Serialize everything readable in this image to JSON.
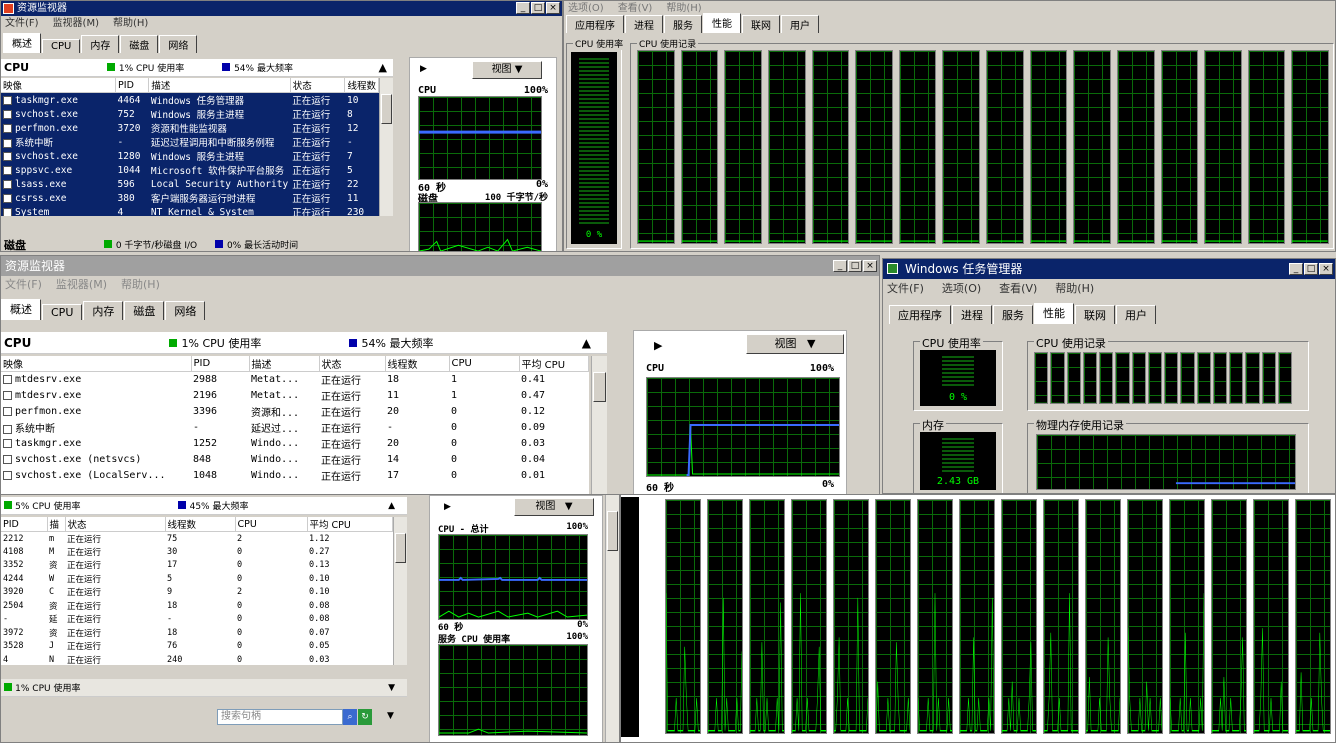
{
  "top_rm": {
    "title": "资源监视器",
    "menu": [
      "文件(F)",
      "监视器(M)",
      "帮助(H)"
    ],
    "tabs": [
      "概述",
      "CPU",
      "内存",
      "磁盘",
      "网络"
    ],
    "cpu_head": {
      "label": "CPU",
      "usage": "1% CPU 使用率",
      "freq": "54% 最大频率"
    },
    "columns": [
      "映像",
      "PID",
      "描述",
      "状态",
      "线程数"
    ],
    "rows": [
      [
        "taskmgr.exe",
        "4464",
        "Windows 任务管理器",
        "正在运行",
        "10"
      ],
      [
        "svchost.exe",
        "752",
        "Windows 服务主进程",
        "正在运行",
        "8"
      ],
      [
        "perfmon.exe",
        "3720",
        "资源和性能监视器",
        "正在运行",
        "12"
      ],
      [
        "系统中断",
        "-",
        "延迟过程调用和中断服务例程",
        "正在运行",
        "-"
      ],
      [
        "svchost.exe",
        "1280",
        "Windows 服务主进程",
        "正在运行",
        "7"
      ],
      [
        "sppsvc.exe",
        "1044",
        "Microsoft 软件保护平台服务",
        "正在运行",
        "5"
      ],
      [
        "lsass.exe",
        "596",
        "Local Security Authority",
        "正在运行",
        "22"
      ],
      [
        "csrss.exe",
        "380",
        "客户端服务器运行时进程",
        "正在运行",
        "11"
      ],
      [
        "System",
        "4",
        "NT Kernel & System",
        "正在运行",
        "230"
      ]
    ],
    "disk_head": {
      "label": "磁盘",
      "io": "0 千字节/秒磁盘 I/O",
      "active": "0% 最长活动时间"
    },
    "view_btn": "视图",
    "graph_cpu": {
      "label": "CPU",
      "max": "100%"
    },
    "graph_axis": {
      "time": "60 秒",
      "min": "0%"
    },
    "graph_disk": {
      "label": "磁盘",
      "max": "100 千字节/秒"
    }
  },
  "top_tm": {
    "menu": [
      "选项(O)",
      "查看(V)",
      "帮助(H)"
    ],
    "tabs": [
      "应用程序",
      "进程",
      "服务",
      "性能",
      "联网",
      "用户"
    ],
    "cpu_usage_label": "CPU 使用率",
    "cpu_history_label": "CPU 使用记录",
    "cpu_pct": "0 %"
  },
  "mid_rm": {
    "title": "资源监视器",
    "menu": [
      "文件(F)",
      "监视器(M)",
      "帮助(H)"
    ],
    "tabs": [
      "概述",
      "CPU",
      "内存",
      "磁盘",
      "网络"
    ],
    "cpu_head": {
      "label": "CPU",
      "usage": "1% CPU 使用率",
      "freq": "54% 最大频率"
    },
    "columns": [
      "映像",
      "PID",
      "描述",
      "状态",
      "线程数",
      "CPU",
      "平均 CPU"
    ],
    "rows": [
      [
        "mtdesrv.exe",
        "2988",
        "Metat...",
        "正在运行",
        "18",
        "1",
        "0.41"
      ],
      [
        "mtdesrv.exe",
        "2196",
        "Metat...",
        "正在运行",
        "11",
        "1",
        "0.47"
      ],
      [
        "perfmon.exe",
        "3396",
        "资源和...",
        "正在运行",
        "20",
        "0",
        "0.12"
      ],
      [
        "系统中断",
        "-",
        "延迟过...",
        "正在运行",
        "-",
        "0",
        "0.09"
      ],
      [
        "taskmgr.exe",
        "1252",
        "Windo...",
        "正在运行",
        "20",
        "0",
        "0.03"
      ],
      [
        "svchost.exe (netsvcs)",
        "848",
        "Windo...",
        "正在运行",
        "14",
        "0",
        "0.04"
      ],
      [
        "svchost.exe (LocalServ...",
        "1048",
        "Windo...",
        "正在运行",
        "17",
        "0",
        "0.01"
      ]
    ],
    "view_btn": "视图",
    "graph_cpu": {
      "label": "CPU",
      "max": "100%"
    },
    "graph_axis": {
      "time": "60 秒",
      "min": "0%"
    }
  },
  "mid_tm": {
    "title": "Windows 任务管理器",
    "menu": [
      "文件(F)",
      "选项(O)",
      "查看(V)",
      "帮助(H)"
    ],
    "tabs": [
      "应用程序",
      "进程",
      "服务",
      "性能",
      "联网",
      "用户"
    ],
    "cpu_usage_label": "CPU 使用率",
    "cpu_history_label": "CPU 使用记录",
    "cpu_pct": "0 %",
    "mem_label": "内存",
    "mem_history_label": "物理内存使用记录",
    "mem_value": "2.43 GB"
  },
  "bot_rm": {
    "cpu_head": {
      "usage": "5% CPU 使用率",
      "freq": "45% 最大频率"
    },
    "columns": [
      "PID",
      "描",
      "状态",
      "线程数",
      "CPU",
      "平均 CPU"
    ],
    "rows": [
      [
        "2212",
        "m",
        "正在运行",
        "75",
        "2",
        "1.12"
      ],
      [
        "4108",
        "M",
        "正在运行",
        "30",
        "0",
        "0.27"
      ],
      [
        "3352",
        "资",
        "正在运行",
        "17",
        "0",
        "0.13"
      ],
      [
        "4244",
        "W",
        "正在运行",
        "5",
        "0",
        "0.10"
      ],
      [
        "3920",
        "C",
        "正在运行",
        "9",
        "2",
        "0.10"
      ],
      [
        "2504",
        "资",
        "正在运行",
        "18",
        "0",
        "0.08"
      ],
      [
        "-",
        "延",
        "正在运行",
        "-",
        "0",
        "0.08"
      ],
      [
        "3972",
        "资",
        "正在运行",
        "18",
        "0",
        "0.07"
      ],
      [
        "3528",
        "J",
        "正在运行",
        "76",
        "0",
        "0.05"
      ],
      [
        "4",
        "N",
        "正在运行",
        "240",
        "0",
        "0.03"
      ]
    ],
    "cpu_head2": {
      "usage": "1% CPU 使用率"
    },
    "search_placeholder": "搜索句柄",
    "view_btn": "视图",
    "graph_total": {
      "label": "CPU - 总计",
      "max": "100%"
    },
    "graph_axis": {
      "time": "60 秒",
      "min": "0%"
    },
    "graph_service": {
      "label": "服务 CPU 使用率",
      "max": "100%"
    }
  }
}
